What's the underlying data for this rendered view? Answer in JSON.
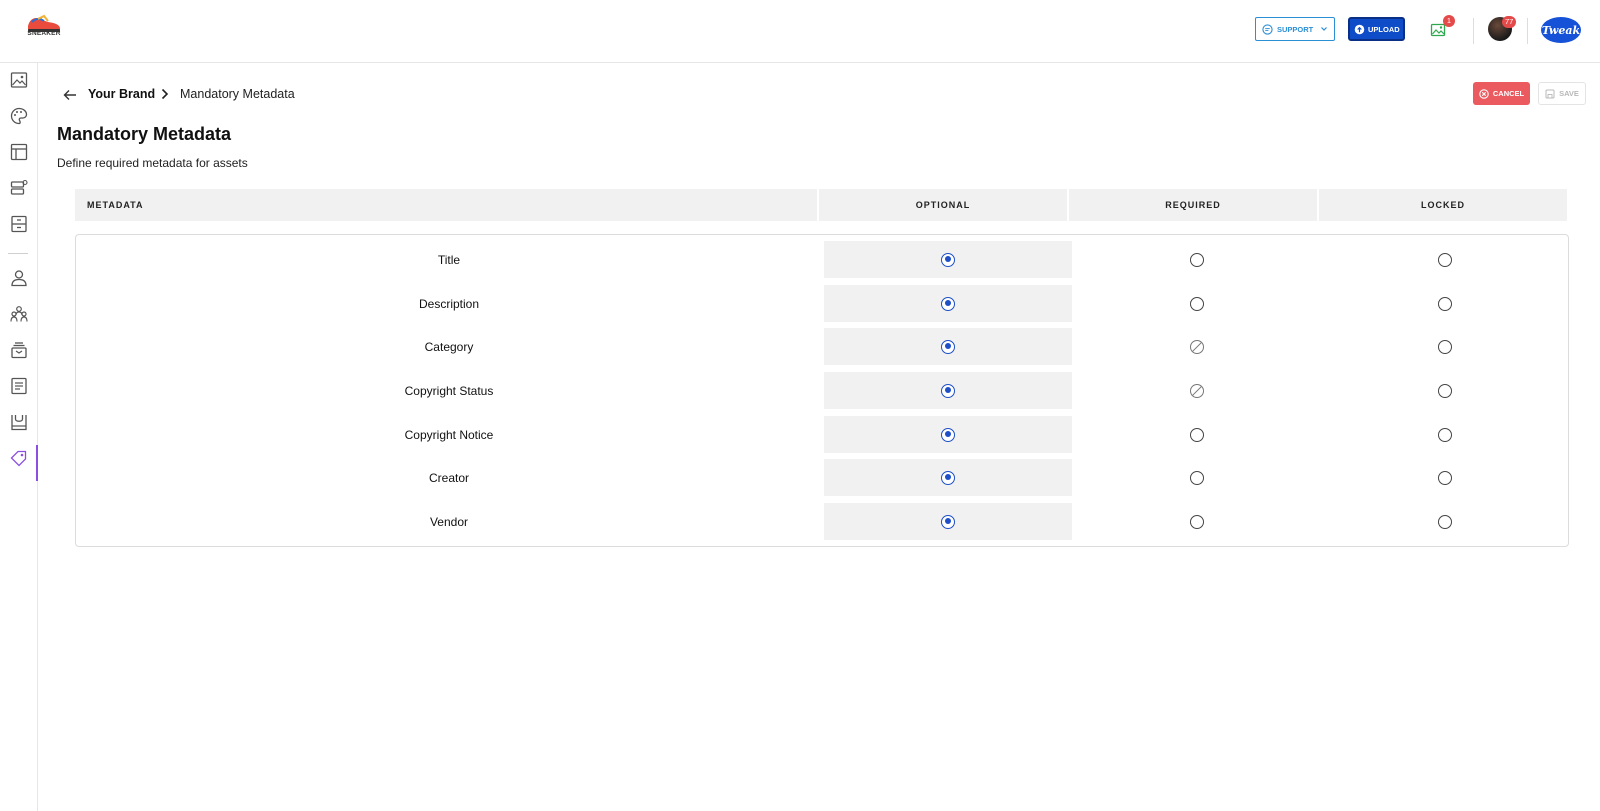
{
  "app": {
    "logo_text": "SNEAKER",
    "support_label": "SUPPORT",
    "upload_label": "UPLOAD",
    "gallery_badge": "1",
    "avatar_badge": "77",
    "brand_logo_text": "Tweak"
  },
  "sidebar": {
    "items": [
      {
        "icon": "image-icon"
      },
      {
        "icon": "palette-icon"
      },
      {
        "icon": "layout-icon"
      },
      {
        "icon": "database-settings-icon"
      },
      {
        "icon": "archive-icon"
      },
      {
        "icon": "user-icon"
      },
      {
        "icon": "users-group-icon"
      },
      {
        "icon": "inbox-stack-icon"
      },
      {
        "icon": "document-list-icon"
      },
      {
        "icon": "store-icon"
      },
      {
        "icon": "tag-icon",
        "active": true
      }
    ]
  },
  "breadcrumb": {
    "parent": "Your Brand",
    "current": "Mandatory Metadata"
  },
  "actions": {
    "cancel_label": "CANCEL",
    "save_label": "SAVE"
  },
  "page": {
    "title": "Mandatory Metadata",
    "subtitle": "Define required metadata for assets"
  },
  "table": {
    "headers": {
      "metadata": "METADATA",
      "optional": "OPTIONAL",
      "required": "REQUIRED",
      "locked": "LOCKED"
    },
    "rows": [
      {
        "name": "Title",
        "selected": "optional",
        "required_disabled": false
      },
      {
        "name": "Description",
        "selected": "optional",
        "required_disabled": false
      },
      {
        "name": "Category",
        "selected": "optional",
        "required_disabled": true
      },
      {
        "name": "Copyright Status",
        "selected": "optional",
        "required_disabled": true
      },
      {
        "name": "Copyright Notice",
        "selected": "optional",
        "required_disabled": false
      },
      {
        "name": "Creator",
        "selected": "optional",
        "required_disabled": false
      },
      {
        "name": "Vendor",
        "selected": "optional",
        "required_disabled": false
      }
    ]
  },
  "colors": {
    "accent": "#1e4fc6",
    "upload": "#0f4cc7",
    "cancel": "#eb5a5f",
    "support": "#2b8fd6",
    "sidebar_active": "#8a4fe0"
  }
}
